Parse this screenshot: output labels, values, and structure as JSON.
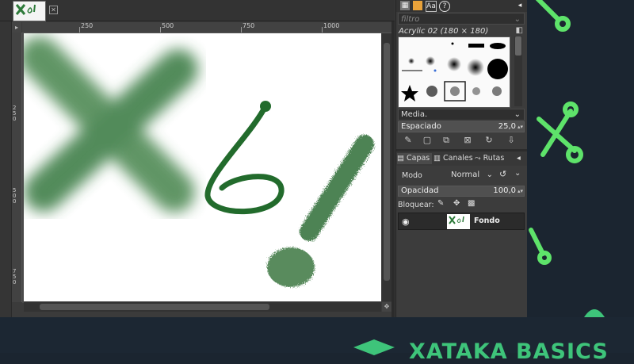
{
  "image_tab": {
    "close_icon": "close-icon"
  },
  "ruler": {
    "marks": [
      "250",
      "500",
      "750",
      "1000"
    ],
    "v_marks": [
      "250",
      "500",
      "750"
    ]
  },
  "brushes": {
    "filter_placeholder": "filtro",
    "current_brush": "Acrylic 02 (180 × 180)",
    "category": "Media.",
    "spacing_label": "Espaciado",
    "spacing_value": "25,0"
  },
  "layers": {
    "tabs": [
      "Capas",
      "Canales",
      "Rutas"
    ],
    "mode_label": "Modo",
    "mode_value": "Normal",
    "opacity_label": "Opacidad",
    "opacity_value": "100,0",
    "lock_label": "Bloquear:",
    "items": [
      {
        "name": "Fondo"
      }
    ]
  },
  "brand": {
    "text": "XATAKA BASICS"
  },
  "colors": {
    "accent": "#3ec47a",
    "paint": "#2e7a3a"
  }
}
